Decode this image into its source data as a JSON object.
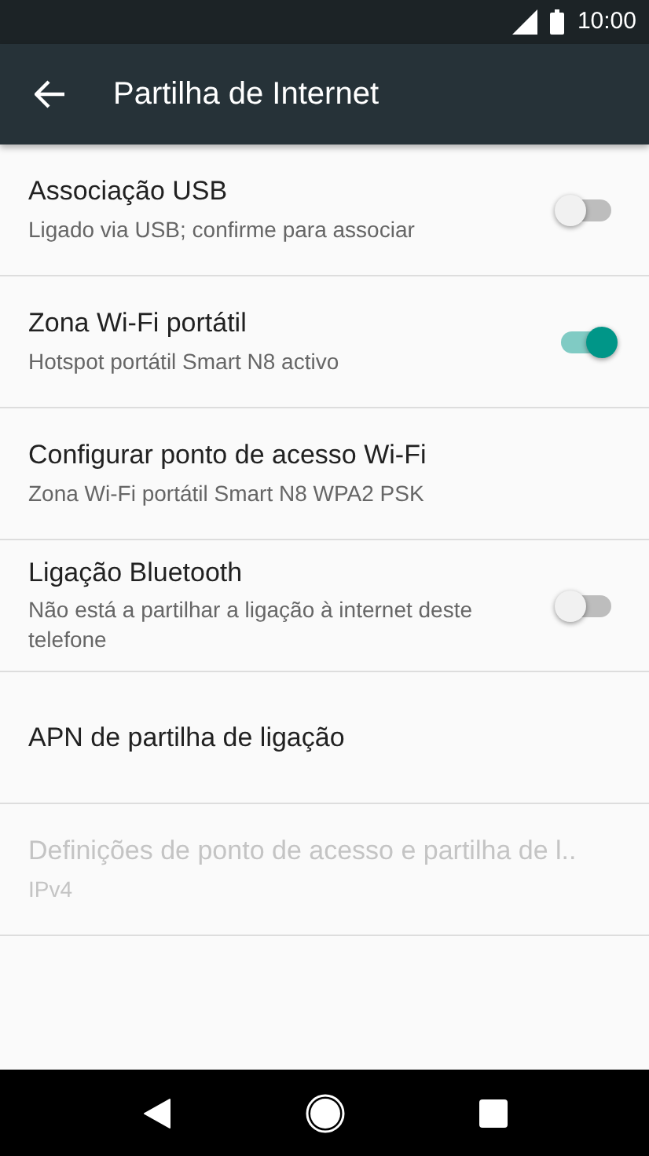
{
  "status_bar": {
    "time": "10:00"
  },
  "app_bar": {
    "title": "Partilha de Internet"
  },
  "items": [
    {
      "kind": "toggle",
      "title": "Associação USB",
      "subtitle": "Ligado via USB; confirme para associar",
      "on": false,
      "disabled": false
    },
    {
      "kind": "toggle",
      "title": "Zona Wi-Fi portátil",
      "subtitle": "Hotspot portátil Smart N8 activo",
      "on": true,
      "disabled": false
    },
    {
      "kind": "plain",
      "title": "Configurar ponto de acesso Wi-Fi",
      "subtitle": "Zona Wi-Fi portátil Smart N8 WPA2 PSK",
      "disabled": false
    },
    {
      "kind": "toggle",
      "title": "Ligação Bluetooth",
      "subtitle": "Não está a partilhar a ligação à internet deste telefone",
      "on": false,
      "disabled": false
    },
    {
      "kind": "plain",
      "title": "APN de partilha de ligação",
      "disabled": false
    },
    {
      "kind": "plain",
      "title": "Definições de ponto de acesso e partilha de l..",
      "subtitle": "IPv4",
      "disabled": true
    }
  ]
}
